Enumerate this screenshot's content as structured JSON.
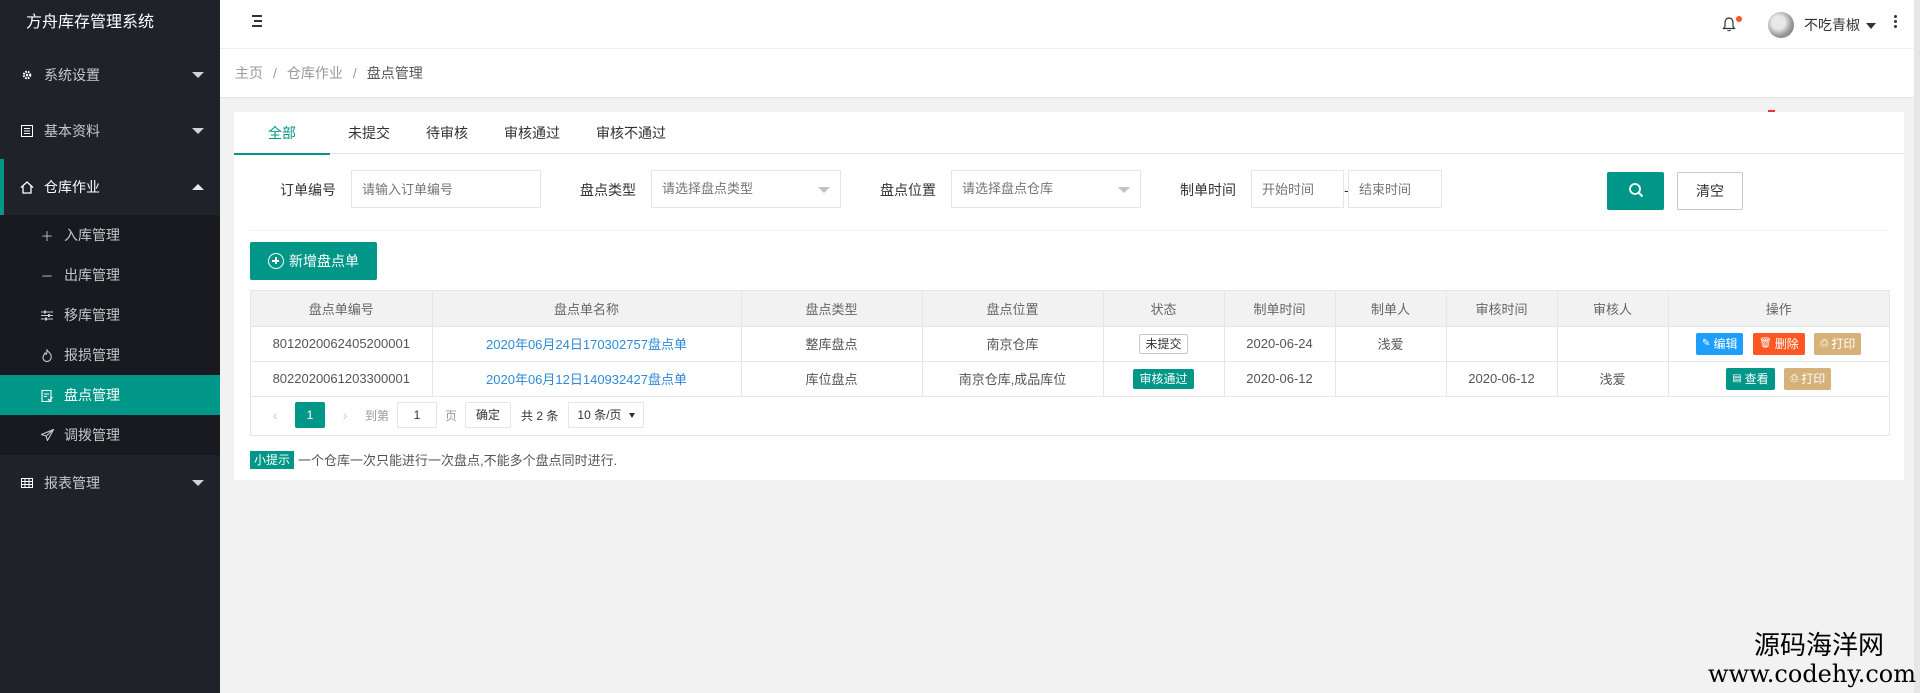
{
  "app": {
    "title": "方舟库存管理系统"
  },
  "sidebar": {
    "items": [
      {
        "label": "系统设置",
        "icon": "gear-icon",
        "open": false
      },
      {
        "label": "基本资料",
        "icon": "list-icon",
        "open": false
      },
      {
        "label": "仓库作业",
        "icon": "home-icon",
        "open": true
      },
      {
        "label": "报表管理",
        "icon": "table-icon",
        "open": false
      }
    ],
    "sub_items": [
      {
        "label": "入库管理",
        "icon": "plus-icon"
      },
      {
        "label": "出库管理",
        "icon": "minus-icon"
      },
      {
        "label": "移库管理",
        "icon": "sliders-icon"
      },
      {
        "label": "报损管理",
        "icon": "fire-icon"
      },
      {
        "label": "盘点管理",
        "icon": "clipboard-icon",
        "active": true
      },
      {
        "label": "调拨管理",
        "icon": "send-icon"
      }
    ]
  },
  "header": {
    "username": "不吃青椒"
  },
  "breadcrumb": {
    "home": "主页",
    "section": "仓库作业",
    "current": "盘点管理"
  },
  "tabs": [
    "全部",
    "未提交",
    "待审核",
    "审核通过",
    "审核不通过"
  ],
  "filter": {
    "order_no_label": "订单编号",
    "order_no_placeholder": "请输入订单编号",
    "type_label": "盘点类型",
    "type_placeholder": "请选择盘点类型",
    "location_label": "盘点位置",
    "location_placeholder": "请选择盘点仓库",
    "time_label": "制单时间",
    "start_placeholder": "开始时间",
    "end_placeholder": "结束时间",
    "dash": "-",
    "clear_label": "清空"
  },
  "toolbar": {
    "add_label": "新增盘点单"
  },
  "table": {
    "columns": [
      "盘点单编号",
      "盘点单名称",
      "盘点类型",
      "盘点位置",
      "状态",
      "制单时间",
      "制单人",
      "审核时间",
      "审核人",
      "操作"
    ],
    "rows": [
      {
        "no": "8012020062405200001",
        "name": "2020年06月24日170302757盘点单",
        "type": "整库盘点",
        "location": "南京仓库",
        "status": "未提交",
        "created": "2020-06-24",
        "creator": "浅爱",
        "audit_time": "",
        "auditor": "",
        "actions": [
          "编辑",
          "删除",
          "打印"
        ]
      },
      {
        "no": "8022020061203300001",
        "name": "2020年06月12日140932427盘点单",
        "type": "库位盘点",
        "location": "南京仓库,成品库位",
        "status": "审核通过",
        "created": "2020-06-12",
        "creator": "",
        "audit_time": "2020-06-12",
        "auditor": "浅爱",
        "actions": [
          "查看",
          "打印"
        ]
      }
    ]
  },
  "pager": {
    "current": "1",
    "goto_label": "到第",
    "goto_value": "1",
    "page_unit": "页",
    "confirm": "确定",
    "total": "共 2 条",
    "page_size": "10 条/页"
  },
  "tip": {
    "badge": "小提示",
    "text": "一个仓库一次只能进行一次盘点,不能多个盘点同时进行."
  },
  "watermark": {
    "line1": "源码海洋网",
    "line2": "www.codehy.com"
  },
  "colors": {
    "primary": "#009688",
    "sidebar": "#20222a",
    "link": "#2e8ad9",
    "danger": "#ff5722",
    "info": "#1e9fff",
    "warm": "#d6b179"
  }
}
